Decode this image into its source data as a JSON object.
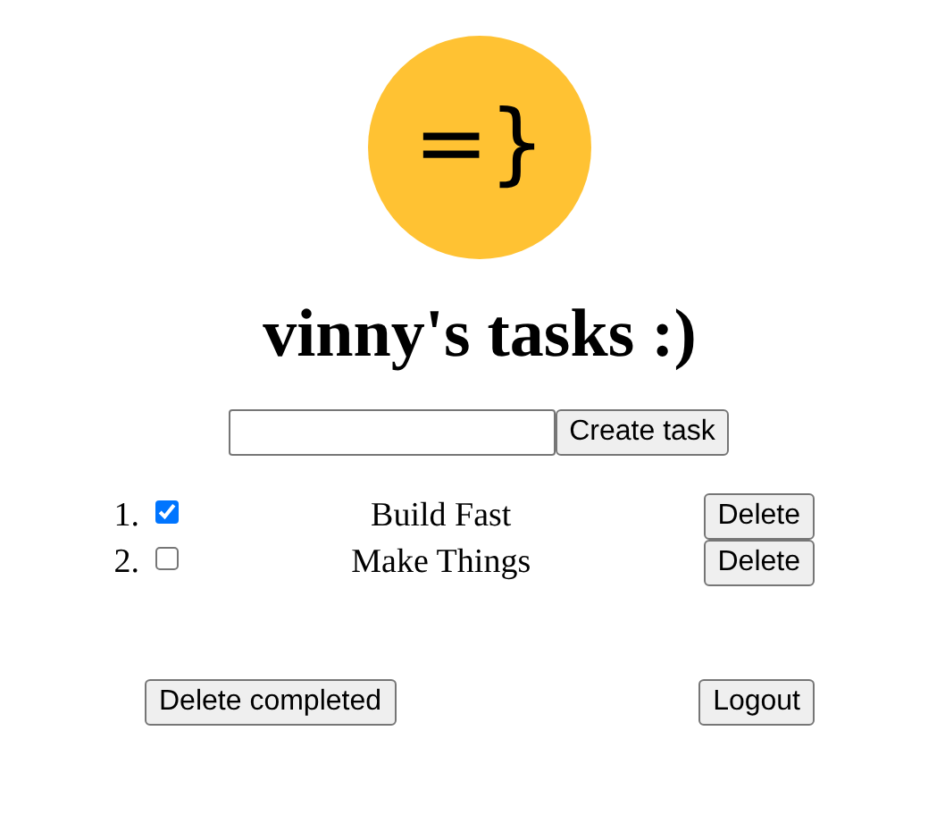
{
  "logo": {
    "text": "=}"
  },
  "title": "vinny's tasks :)",
  "new_task": {
    "button": "Create task"
  },
  "tasks": [
    {
      "number": "1.",
      "checked": true,
      "text": "Build Fast",
      "button": "Delete"
    },
    {
      "number": "2.",
      "checked": false,
      "text": "Make Things",
      "button": "Delete"
    }
  ],
  "footer": {
    "delete_completed": "Delete completed",
    "logout": "Logout"
  }
}
